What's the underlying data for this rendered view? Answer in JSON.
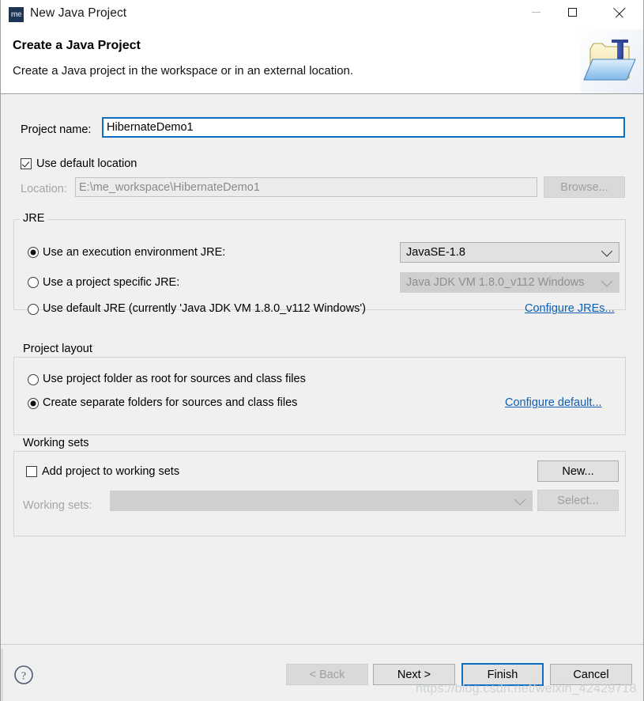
{
  "window": {
    "title": "New Java Project",
    "icon_label": "me",
    "controls": {
      "minimize": "minimize-icon",
      "maximize": "maximize-icon",
      "close": "close-icon"
    }
  },
  "header": {
    "title": "Create a Java Project",
    "subtitle": "Create a Java project in the workspace or in an external location.",
    "banner_icon": "java-project-folder-icon"
  },
  "project": {
    "name_label": "Project name:",
    "name_value": "HibernateDemo1",
    "use_default_location_label": "Use default location",
    "use_default_location_checked": true,
    "location_label": "Location:",
    "location_value": "E:\\me_workspace\\HibernateDemo1",
    "browse_label": "Browse..."
  },
  "jre": {
    "group_title": "JRE",
    "options": [
      {
        "label": "Use an execution environment JRE:",
        "selected": true
      },
      {
        "label": "Use a project specific JRE:",
        "selected": false
      },
      {
        "label": "Use default JRE (currently 'Java JDK VM 1.8.0_v112 Windows')",
        "selected": false
      }
    ],
    "execution_env_value": "JavaSE-1.8",
    "project_jre_value": "Java JDK VM 1.8.0_v112 Windows",
    "configure_link": "Configure JREs..."
  },
  "layout": {
    "group_title": "Project layout",
    "options": [
      {
        "label": "Use project folder as root for sources and class files",
        "selected": false
      },
      {
        "label": "Create separate folders for sources and class files",
        "selected": true
      }
    ],
    "configure_link": "Configure default..."
  },
  "working_sets": {
    "group_title": "Working sets",
    "add_label": "Add project to working sets",
    "add_checked": false,
    "new_label": "New...",
    "sets_label": "Working sets:",
    "sets_value": "",
    "select_label": "Select..."
  },
  "buttons": {
    "help": "help-icon",
    "back": "< Back",
    "next": "Next >",
    "finish": "Finish",
    "cancel": "Cancel"
  },
  "watermark": "https://blog.csdn.net/weixin_42429718",
  "colors": {
    "accent": "#0c6fc4",
    "link": "#0d5fb5",
    "dialog_bg": "#f0f0f0",
    "header_bg": "#ffffff",
    "title_icon_bg": "#1c3557"
  }
}
